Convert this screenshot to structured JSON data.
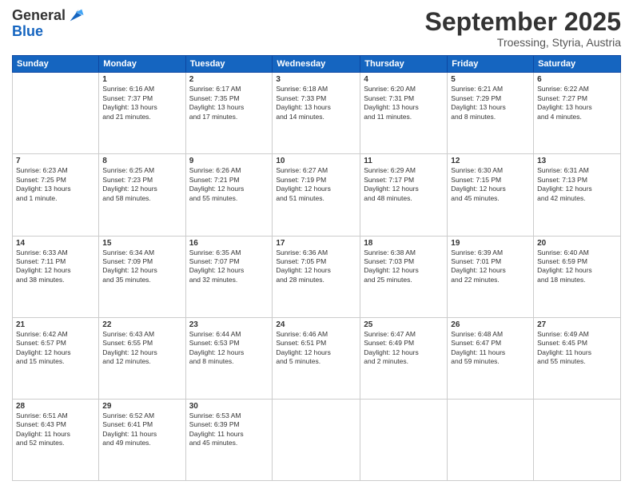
{
  "logo": {
    "general": "General",
    "blue": "Blue"
  },
  "header": {
    "month": "September 2025",
    "location": "Troessing, Styria, Austria"
  },
  "weekdays": [
    "Sunday",
    "Monday",
    "Tuesday",
    "Wednesday",
    "Thursday",
    "Friday",
    "Saturday"
  ],
  "weeks": [
    [
      {
        "day": "",
        "info": ""
      },
      {
        "day": "1",
        "info": "Sunrise: 6:16 AM\nSunset: 7:37 PM\nDaylight: 13 hours\nand 21 minutes."
      },
      {
        "day": "2",
        "info": "Sunrise: 6:17 AM\nSunset: 7:35 PM\nDaylight: 13 hours\nand 17 minutes."
      },
      {
        "day": "3",
        "info": "Sunrise: 6:18 AM\nSunset: 7:33 PM\nDaylight: 13 hours\nand 14 minutes."
      },
      {
        "day": "4",
        "info": "Sunrise: 6:20 AM\nSunset: 7:31 PM\nDaylight: 13 hours\nand 11 minutes."
      },
      {
        "day": "5",
        "info": "Sunrise: 6:21 AM\nSunset: 7:29 PM\nDaylight: 13 hours\nand 8 minutes."
      },
      {
        "day": "6",
        "info": "Sunrise: 6:22 AM\nSunset: 7:27 PM\nDaylight: 13 hours\nand 4 minutes."
      }
    ],
    [
      {
        "day": "7",
        "info": "Sunrise: 6:23 AM\nSunset: 7:25 PM\nDaylight: 13 hours\nand 1 minute."
      },
      {
        "day": "8",
        "info": "Sunrise: 6:25 AM\nSunset: 7:23 PM\nDaylight: 12 hours\nand 58 minutes."
      },
      {
        "day": "9",
        "info": "Sunrise: 6:26 AM\nSunset: 7:21 PM\nDaylight: 12 hours\nand 55 minutes."
      },
      {
        "day": "10",
        "info": "Sunrise: 6:27 AM\nSunset: 7:19 PM\nDaylight: 12 hours\nand 51 minutes."
      },
      {
        "day": "11",
        "info": "Sunrise: 6:29 AM\nSunset: 7:17 PM\nDaylight: 12 hours\nand 48 minutes."
      },
      {
        "day": "12",
        "info": "Sunrise: 6:30 AM\nSunset: 7:15 PM\nDaylight: 12 hours\nand 45 minutes."
      },
      {
        "day": "13",
        "info": "Sunrise: 6:31 AM\nSunset: 7:13 PM\nDaylight: 12 hours\nand 42 minutes."
      }
    ],
    [
      {
        "day": "14",
        "info": "Sunrise: 6:33 AM\nSunset: 7:11 PM\nDaylight: 12 hours\nand 38 minutes."
      },
      {
        "day": "15",
        "info": "Sunrise: 6:34 AM\nSunset: 7:09 PM\nDaylight: 12 hours\nand 35 minutes."
      },
      {
        "day": "16",
        "info": "Sunrise: 6:35 AM\nSunset: 7:07 PM\nDaylight: 12 hours\nand 32 minutes."
      },
      {
        "day": "17",
        "info": "Sunrise: 6:36 AM\nSunset: 7:05 PM\nDaylight: 12 hours\nand 28 minutes."
      },
      {
        "day": "18",
        "info": "Sunrise: 6:38 AM\nSunset: 7:03 PM\nDaylight: 12 hours\nand 25 minutes."
      },
      {
        "day": "19",
        "info": "Sunrise: 6:39 AM\nSunset: 7:01 PM\nDaylight: 12 hours\nand 22 minutes."
      },
      {
        "day": "20",
        "info": "Sunrise: 6:40 AM\nSunset: 6:59 PM\nDaylight: 12 hours\nand 18 minutes."
      }
    ],
    [
      {
        "day": "21",
        "info": "Sunrise: 6:42 AM\nSunset: 6:57 PM\nDaylight: 12 hours\nand 15 minutes."
      },
      {
        "day": "22",
        "info": "Sunrise: 6:43 AM\nSunset: 6:55 PM\nDaylight: 12 hours\nand 12 minutes."
      },
      {
        "day": "23",
        "info": "Sunrise: 6:44 AM\nSunset: 6:53 PM\nDaylight: 12 hours\nand 8 minutes."
      },
      {
        "day": "24",
        "info": "Sunrise: 6:46 AM\nSunset: 6:51 PM\nDaylight: 12 hours\nand 5 minutes."
      },
      {
        "day": "25",
        "info": "Sunrise: 6:47 AM\nSunset: 6:49 PM\nDaylight: 12 hours\nand 2 minutes."
      },
      {
        "day": "26",
        "info": "Sunrise: 6:48 AM\nSunset: 6:47 PM\nDaylight: 11 hours\nand 59 minutes."
      },
      {
        "day": "27",
        "info": "Sunrise: 6:49 AM\nSunset: 6:45 PM\nDaylight: 11 hours\nand 55 minutes."
      }
    ],
    [
      {
        "day": "28",
        "info": "Sunrise: 6:51 AM\nSunset: 6:43 PM\nDaylight: 11 hours\nand 52 minutes."
      },
      {
        "day": "29",
        "info": "Sunrise: 6:52 AM\nSunset: 6:41 PM\nDaylight: 11 hours\nand 49 minutes."
      },
      {
        "day": "30",
        "info": "Sunrise: 6:53 AM\nSunset: 6:39 PM\nDaylight: 11 hours\nand 45 minutes."
      },
      {
        "day": "",
        "info": ""
      },
      {
        "day": "",
        "info": ""
      },
      {
        "day": "",
        "info": ""
      },
      {
        "day": "",
        "info": ""
      }
    ]
  ]
}
